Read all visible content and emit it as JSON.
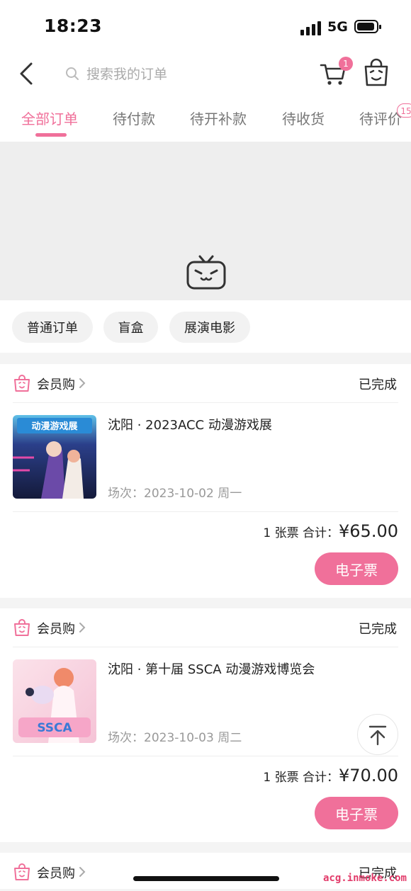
{
  "status_bar": {
    "time": "18:23",
    "network": "5G"
  },
  "header": {
    "search_placeholder": "搜索我的订单",
    "cart_badge": "1"
  },
  "tabs": [
    {
      "label": "全部订单",
      "active": true
    },
    {
      "label": "待付款"
    },
    {
      "label": "待开补款"
    },
    {
      "label": "待收货"
    },
    {
      "label": "待评价",
      "badge": "15"
    }
  ],
  "filters": [
    "普通订单",
    "盲盒",
    "展演电影"
  ],
  "orders": [
    {
      "shop": "会员购",
      "status": "已完成",
      "title": "沈阳 · 2023ACC 动漫游戏展",
      "session": "场次：2023-10-02 周一",
      "qty": "1 张票  合计：",
      "amount": "¥65.00",
      "button": "电子票",
      "thumb_text": "动漫游戏展"
    },
    {
      "shop": "会员购",
      "status": "已完成",
      "title": "沈阳 · 第十届 SSCA 动漫游戏博览会",
      "session": "场次：2023-10-03 周二",
      "qty": "1 张票  合计：",
      "amount": "¥70.00",
      "button": "电子票",
      "thumb_text": "SSCA"
    },
    {
      "shop": "会员购",
      "status": "已完成"
    }
  ],
  "watermark": "acg.inmoke.com",
  "colors": {
    "accent": "#f0709a",
    "background": "#f4f4f4"
  }
}
